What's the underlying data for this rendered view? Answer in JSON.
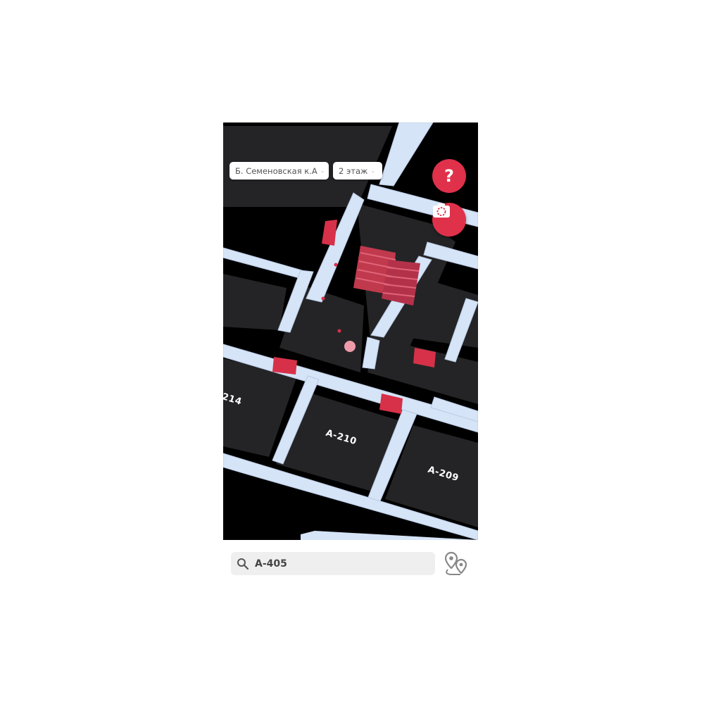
{
  "header": {
    "building": "Б. Семеновская к.А",
    "floor": "2 этаж"
  },
  "map": {
    "rooms": [
      "214",
      "А-210",
      "А-209"
    ]
  },
  "search": {
    "value": "А-405"
  },
  "icons": {
    "help": "question-mark-icon",
    "camera": "camera-icon",
    "search": "search-icon",
    "route": "route-pins-icon"
  },
  "colors": {
    "accent": "#e0314b",
    "walls": "#d6e4f7",
    "floor": "#252527"
  }
}
